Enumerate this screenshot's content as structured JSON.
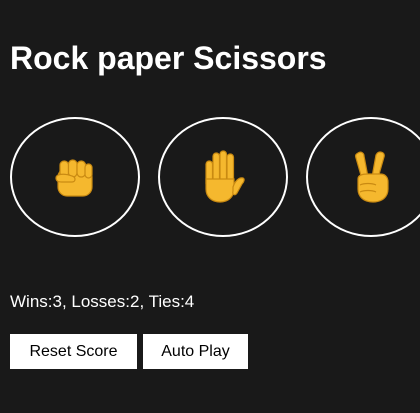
{
  "title": "Rock paper Scissors",
  "moves": [
    {
      "icon": "rock-fist-icon",
      "emoji_color": "#F5B82E"
    },
    {
      "icon": "paper-hand-icon",
      "emoji_color": "#F5B82E"
    },
    {
      "icon": "scissors-victory-hand-icon",
      "emoji_color": "#F5B82E"
    }
  ],
  "score_text": "Wins:3, Losses:2, Ties:4",
  "score": {
    "wins": 3,
    "losses": 2,
    "ties": 4
  },
  "buttons": {
    "reset_label": "Reset Score",
    "auto_play_label": "Auto Play"
  },
  "colors": {
    "background": "#191919",
    "text": "#FFFFFF",
    "button_bg": "#FFFFFF",
    "button_text": "#000000",
    "emoji": "#F5B82E"
  }
}
